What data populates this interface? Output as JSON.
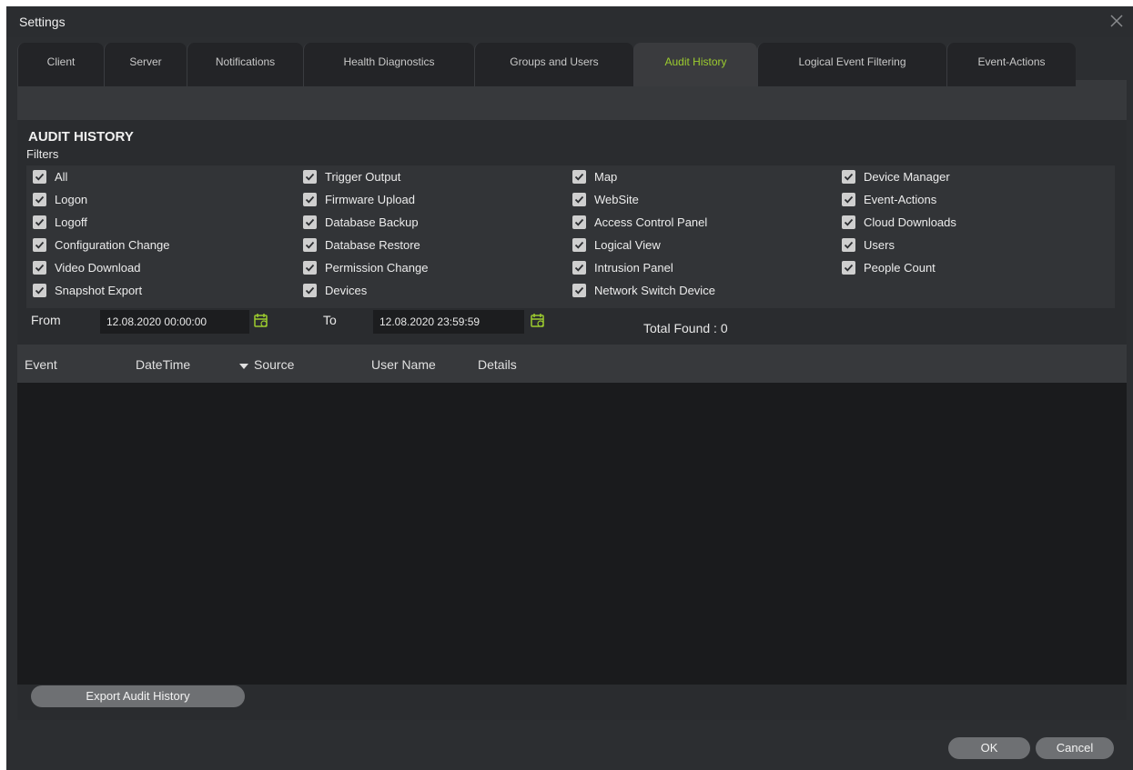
{
  "window": {
    "title": "Settings"
  },
  "tabs": [
    {
      "label": "Client"
    },
    {
      "label": "Server"
    },
    {
      "label": "Notifications"
    },
    {
      "label": "Health Diagnostics"
    },
    {
      "label": "Groups and Users"
    },
    {
      "label": "Audit History"
    },
    {
      "label": "Logical Event Filtering"
    },
    {
      "label": "Event-Actions"
    }
  ],
  "active_tab": "Audit History",
  "section": {
    "title": "AUDIT HISTORY",
    "filters_label": "Filters"
  },
  "filters": {
    "col1": [
      "All",
      "Logon",
      "Logoff",
      "Configuration Change",
      "Video Download",
      "Snapshot Export"
    ],
    "col2": [
      "Trigger Output",
      "Firmware Upload",
      "Database Backup",
      "Database Restore",
      "Permission Change",
      "Devices"
    ],
    "col3": [
      "Map",
      "WebSite",
      "Access Control Panel",
      "Logical View",
      "Intrusion Panel",
      "Network Switch Device"
    ],
    "col4": [
      "Device Manager",
      "Event-Actions",
      "Cloud Downloads",
      "Users",
      "People Count"
    ]
  },
  "date_range": {
    "from_label": "From",
    "from_value": "12.08.2020 00:00:00",
    "to_label": "To",
    "to_value": "12.08.2020 23:59:59",
    "total_found": "Total Found : 0"
  },
  "table": {
    "columns": {
      "event": "Event",
      "datetime": "DateTime",
      "source": "Source",
      "username": "User Name",
      "details": "Details"
    },
    "rows": []
  },
  "buttons": {
    "export": "Export Audit History",
    "ok": "OK",
    "cancel": "Cancel"
  },
  "colors": {
    "accent": "#9ccc2f",
    "tab_active_text": "#9ccc2f",
    "background": "#2c2e31"
  }
}
